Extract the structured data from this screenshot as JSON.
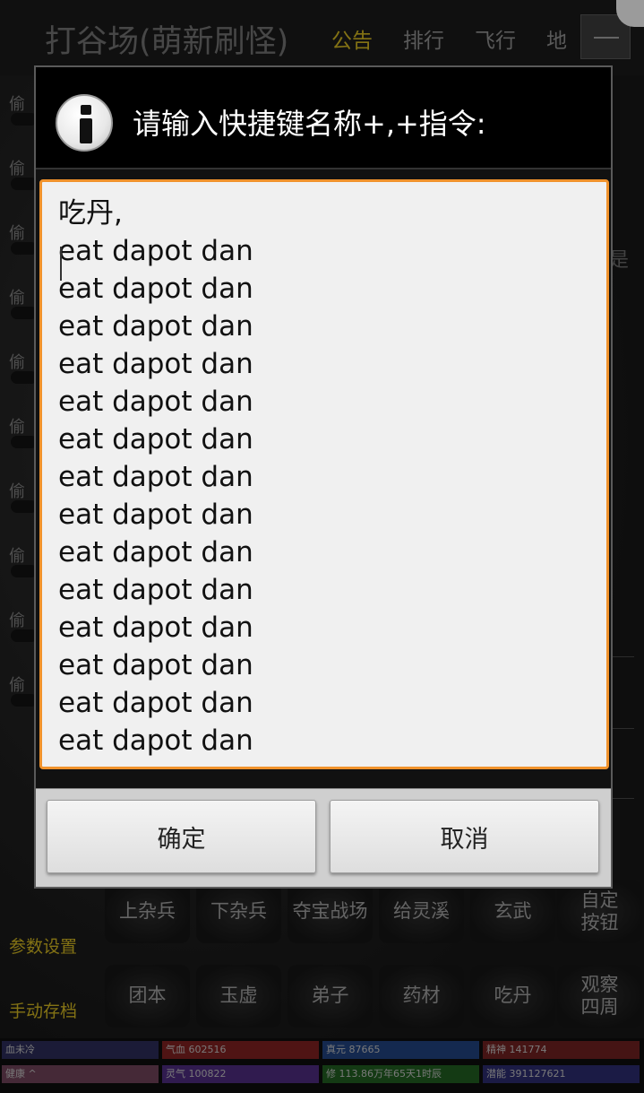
{
  "game": {
    "title": "打谷场(萌新刷怪)",
    "nav_tabs": [
      "公告",
      "排行",
      "飞行",
      "地"
    ],
    "side_label": "偷"
  },
  "right_fragment": "是",
  "grid_buttons": {
    "row1": [
      "上杂兵",
      "下杂兵",
      "夺宝战场",
      "给灵溪",
      "玄武",
      "自定\n按钮"
    ],
    "row2": [
      "团本",
      "玉虚",
      "弟子",
      "药材",
      "吃丹",
      "观察\n四周"
    ]
  },
  "left_buttons": [
    "参数设置",
    "手动存档"
  ],
  "status": {
    "row1": [
      "血未冷",
      "气血 602516",
      "真元 87665",
      "精神 141774"
    ],
    "row2": [
      "健康 ^",
      "灵气 100822",
      "修 113.86万年65天1时辰",
      "潜能 391127621"
    ]
  },
  "status_colors": {
    "row1": [
      "#2a2a55",
      "#7a1f1f",
      "#1f3f7a",
      "#6a1f1f"
    ],
    "row2": [
      "#6a3f55",
      "#4a2a7a",
      "#1f5a1f",
      "#2a2a6a"
    ]
  },
  "dialog": {
    "title": "请输入快捷键名称+,+指令:",
    "icon": "info-icon",
    "input_value": "吃丹,\neat dapot dan\neat dapot dan\neat dapot dan\neat dapot dan\neat dapot dan\neat dapot dan\neat dapot dan\neat dapot dan\neat dapot dan\neat dapot dan\neat dapot dan\neat dapot dan\neat dapot dan\neat dapot dan",
    "confirm_label": "确定",
    "cancel_label": "取消",
    "accent_color": "#f0922c"
  }
}
